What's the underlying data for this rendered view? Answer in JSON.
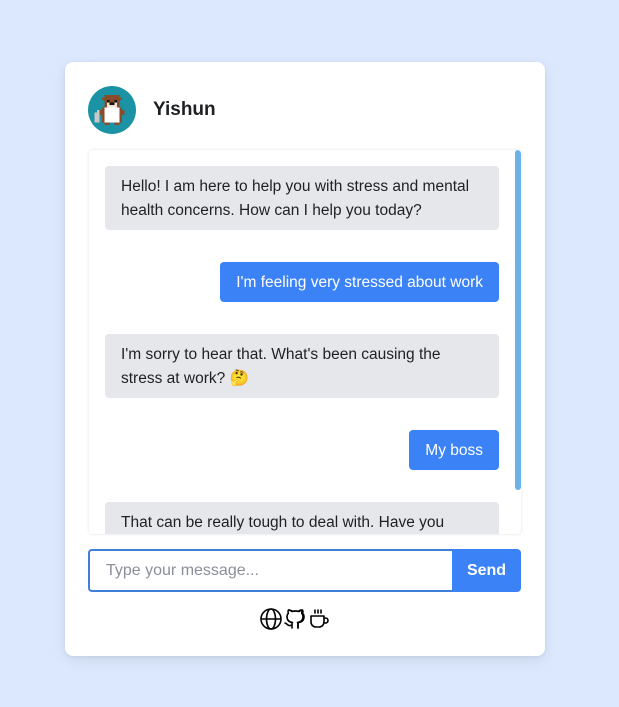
{
  "header": {
    "name": "Yishun",
    "avatar_icon": "otter-mascot-icon"
  },
  "messages": [
    {
      "role": "bot",
      "text": "Hello! I am here to help you with stress and mental health concerns. How can I help you today?"
    },
    {
      "role": "user",
      "text": "I'm feeling very stressed about work"
    },
    {
      "role": "bot",
      "text": "I'm sorry to hear that. What's been causing the stress at work? 🤔"
    },
    {
      "role": "user",
      "text": "My boss"
    },
    {
      "role": "bot",
      "text": "That can be really tough to deal with. Have you"
    }
  ],
  "input": {
    "placeholder": "Type your message...",
    "value": ""
  },
  "send_label": "Send",
  "footer_icons": [
    "globe-icon",
    "github-icon",
    "coffee-icon"
  ],
  "colors": {
    "background": "#dbe8fd",
    "accent": "#3b82f6",
    "bot_bubble": "#e6e7eb",
    "scrollbar": "#6cb2e6"
  }
}
